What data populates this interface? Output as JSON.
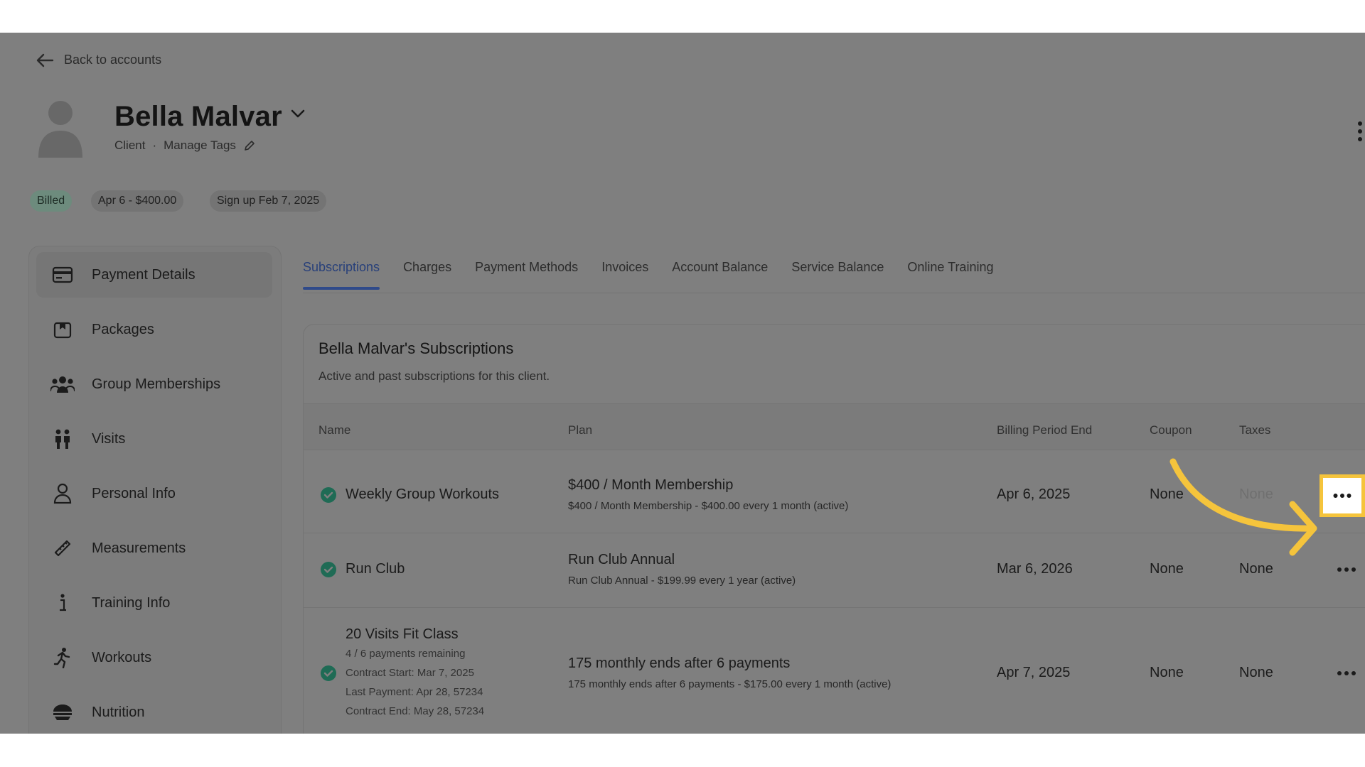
{
  "header": {
    "back_label": "Back to accounts",
    "client_name": "Bella Malvar",
    "role": "Client",
    "separator": "·",
    "manage_tags": "Manage Tags"
  },
  "badges": {
    "status": "Billed",
    "next_bill": "Apr 6 - $400.00",
    "signup": "Sign up Feb 7, 2025"
  },
  "sidebar": {
    "items": [
      {
        "label": "Payment Details",
        "icon": "credit-card-icon"
      },
      {
        "label": "Packages",
        "icon": "package-icon"
      },
      {
        "label": "Group Memberships",
        "icon": "group-icon"
      },
      {
        "label": "Visits",
        "icon": "visits-icon"
      },
      {
        "label": "Personal Info",
        "icon": "person-icon"
      },
      {
        "label": "Measurements",
        "icon": "ruler-icon"
      },
      {
        "label": "Training Info",
        "icon": "info-icon"
      },
      {
        "label": "Workouts",
        "icon": "running-icon"
      },
      {
        "label": "Nutrition",
        "icon": "nutrition-icon"
      }
    ]
  },
  "tabs": [
    "Subscriptions",
    "Charges",
    "Payment Methods",
    "Invoices",
    "Account Balance",
    "Service Balance",
    "Online Training"
  ],
  "subscriptions": {
    "title": "Bella Malvar's Subscriptions",
    "description": "Active and past subscriptions for this client.",
    "columns": {
      "name": "Name",
      "plan": "Plan",
      "billing_period_end": "Billing Period End",
      "coupon": "Coupon",
      "taxes": "Taxes"
    },
    "rows": [
      {
        "name": "Weekly Group Workouts",
        "plan": "$400 / Month Membership",
        "plan_detail": "$400 / Month Membership - $400.00 every 1 month (active)",
        "billing_period_end": "Apr 6, 2025",
        "coupon": "None",
        "taxes": "None"
      },
      {
        "name": "Run Club",
        "plan": "Run Club Annual",
        "plan_detail": "Run Club Annual - $199.99 every 1 year (active)",
        "billing_period_end": "Mar 6, 2026",
        "coupon": "None",
        "taxes": "None"
      },
      {
        "name": "20 Visits Fit Class",
        "meta": [
          "4 / 6 payments remaining",
          "Contract Start: Mar 7, 2025",
          "Last Payment: Apr 28, 57234",
          "Contract End: May 28, 57234"
        ],
        "plan": "175 monthly ends after 6 payments",
        "plan_detail": "175 monthly ends after 6 payments - $175.00 every 1 month (active)",
        "billing_period_end": "Apr 7, 2025",
        "coupon": "None",
        "taxes": "None"
      }
    ]
  },
  "colors": {
    "overlay": "#7f7f7f",
    "highlight": "#f5c43c",
    "active_tab": "#2f4a8a",
    "check": "#1f6b55"
  }
}
